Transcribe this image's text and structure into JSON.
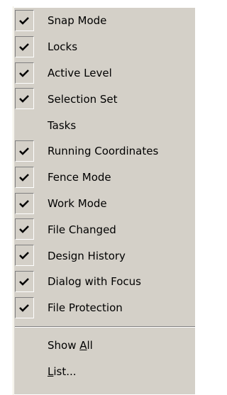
{
  "menu": {
    "items": [
      {
        "label": "Snap Mode",
        "checked": true
      },
      {
        "label": "Locks",
        "checked": true
      },
      {
        "label": "Active Level",
        "checked": true
      },
      {
        "label": "Selection Set",
        "checked": true
      },
      {
        "label": "Tasks",
        "checked": false
      },
      {
        "label": "Running Coordinates",
        "checked": true
      },
      {
        "label": "Fence Mode",
        "checked": true
      },
      {
        "label": "Work Mode",
        "checked": true
      },
      {
        "label": "File Changed",
        "checked": true
      },
      {
        "label": "Design History",
        "checked": true
      },
      {
        "label": "Dialog with Focus",
        "checked": true
      },
      {
        "label": "File Protection",
        "checked": true
      }
    ],
    "show_all": {
      "prefix": "Show ",
      "mnemonic": "A",
      "suffix": "ll"
    },
    "list": {
      "prefix": "",
      "mnemonic": "L",
      "suffix": "ist..."
    }
  },
  "colors": {
    "menu_background": "#d4d0c8",
    "highlight": "#ffffff",
    "shadow": "#808080",
    "text": "#000000"
  },
  "icons": {
    "check": "check-icon"
  }
}
